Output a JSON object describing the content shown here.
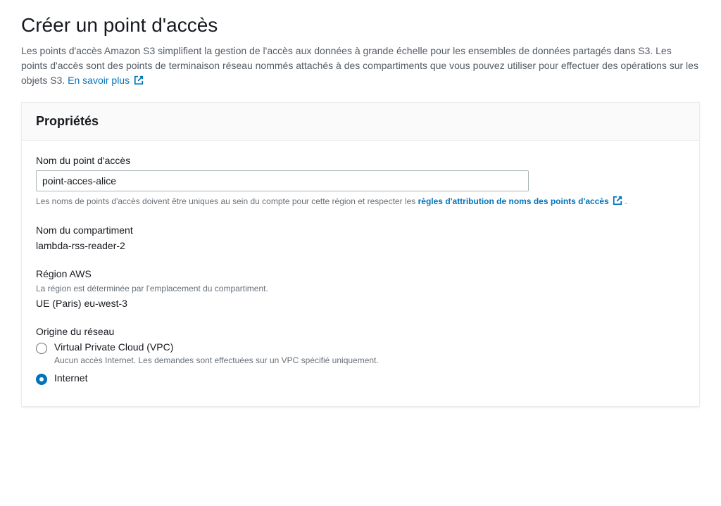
{
  "page": {
    "title": "Créer un point d'accès",
    "description": "Les points d'accès Amazon S3 simplifient la gestion de l'accès aux données à grande échelle pour les ensembles de données partagés dans S3. Les points d'accès sont des points de terminaison réseau nommés attachés à des compartiments que vous pouvez utiliser pour effectuer des opérations sur les objets S3. ",
    "learn_more": "En savoir plus"
  },
  "panel": {
    "title": "Propriétés",
    "access_point_name": {
      "label": "Nom du point d'accès",
      "value": "point-acces-alice",
      "helper_prefix": "Les noms de points d'accès doivent être uniques au sein du compte pour cette région et respecter les ",
      "helper_link": "règles d'attribution de noms des points d'accès",
      "helper_suffix": "."
    },
    "bucket_name": {
      "label": "Nom du compartiment",
      "value": "lambda-rss-reader-2"
    },
    "region": {
      "label": "Région AWS",
      "sub": "La région est déterminée par l'emplacement du compartiment.",
      "value": "UE (Paris) eu-west-3"
    },
    "network_origin": {
      "label": "Origine du réseau",
      "options": [
        {
          "label": "Virtual Private Cloud (VPC)",
          "desc": "Aucun accès Internet. Les demandes sont effectuées sur un VPC spécifié uniquement.",
          "checked": false
        },
        {
          "label": "Internet",
          "desc": "",
          "checked": true
        }
      ]
    }
  }
}
